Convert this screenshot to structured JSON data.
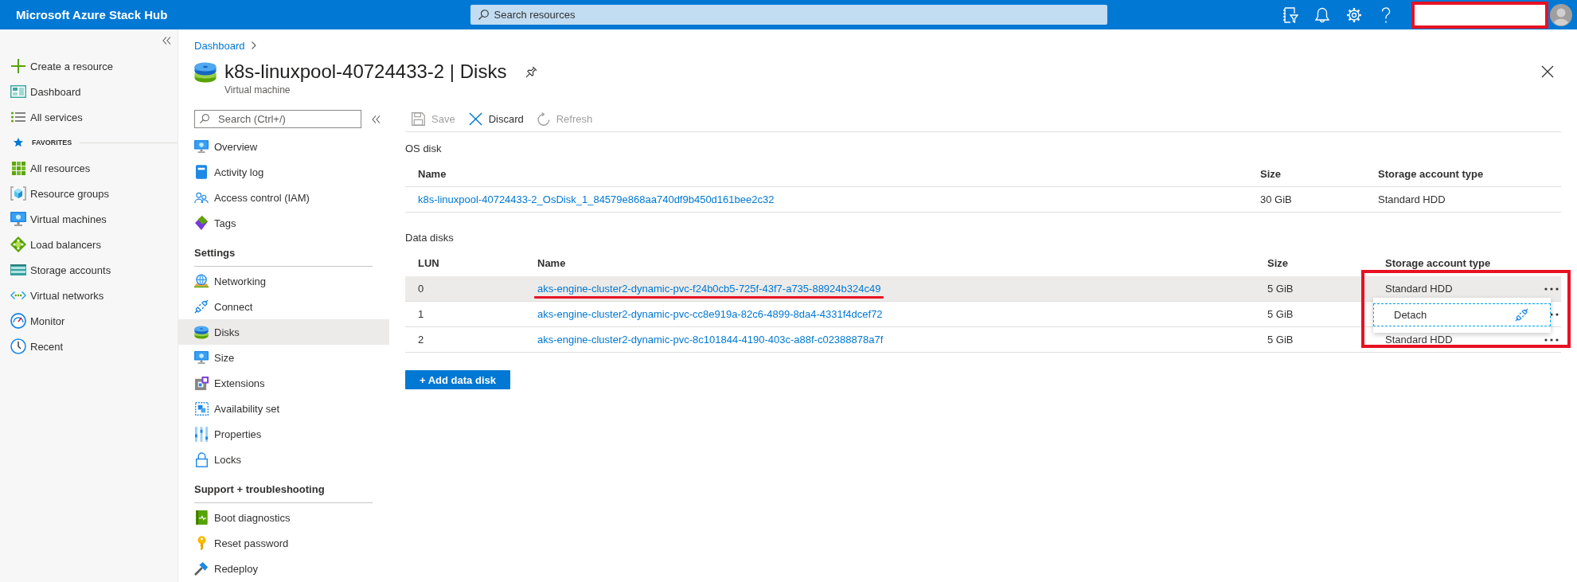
{
  "top_bar": {
    "title": "Microsoft Azure Stack Hub",
    "search": {
      "placeholder": "Search resources"
    }
  },
  "sidebar": {
    "items": [
      {
        "label": "Create a resource",
        "selected": false
      },
      {
        "label": "Dashboard",
        "selected": false
      },
      {
        "label": "All services",
        "selected": false
      }
    ],
    "favorites_label": "FAVORITES",
    "favorites": [
      {
        "label": "All resources",
        "selected": false
      },
      {
        "label": "Resource groups",
        "selected": false
      },
      {
        "label": "Virtual machines",
        "selected": false
      },
      {
        "label": "Load balancers",
        "selected": false
      },
      {
        "label": "Storage accounts",
        "selected": false
      },
      {
        "label": "Virtual networks",
        "selected": false
      },
      {
        "label": "Monitor",
        "selected": false
      },
      {
        "label": "Recent",
        "selected": false
      }
    ]
  },
  "breadcrumb": [
    {
      "label": "Dashboard"
    }
  ],
  "header": {
    "title": "k8s-linuxpool-40724433-2 | Disks",
    "subtitle": "Virtual machine"
  },
  "resource_menu": {
    "search": {
      "placeholder": "Search (Ctrl+/)"
    },
    "groups": [
      {
        "items": [
          {
            "label": "Overview",
            "selected": false
          },
          {
            "label": "Activity log",
            "selected": false
          },
          {
            "label": "Access control (IAM)",
            "selected": false
          },
          {
            "label": "Tags",
            "selected": false
          }
        ]
      },
      {
        "heading": "Settings",
        "items": [
          {
            "label": "Networking",
            "selected": false
          },
          {
            "label": "Connect",
            "selected": false
          },
          {
            "label": "Disks",
            "selected": true
          },
          {
            "label": "Size",
            "selected": false
          },
          {
            "label": "Extensions",
            "selected": false
          },
          {
            "label": "Availability set",
            "selected": false
          },
          {
            "label": "Properties",
            "selected": false
          },
          {
            "label": "Locks",
            "selected": false
          }
        ]
      },
      {
        "heading": "Support + troubleshooting",
        "items": [
          {
            "label": "Boot diagnostics",
            "selected": false
          },
          {
            "label": "Reset password",
            "selected": false
          },
          {
            "label": "Redeploy",
            "selected": false
          }
        ]
      }
    ]
  },
  "toolbar": [
    {
      "label": "Save",
      "disabled": true
    },
    {
      "label": "Discard",
      "disabled": false
    },
    {
      "label": "Refresh",
      "disabled": true
    }
  ],
  "os_disk": {
    "heading": "OS disk",
    "columns": [
      "Name",
      "Size",
      "Storage account type"
    ],
    "rows": [
      {
        "name": "k8s-linuxpool-40724433-2_OsDisk_1_84579e868aa740df9b450d161bee2c32",
        "size": "30 GiB",
        "storage_type": "Standard HDD"
      }
    ]
  },
  "data_disks": {
    "heading": "Data disks",
    "columns": [
      "LUN",
      "Name",
      "Size",
      "Storage account type"
    ],
    "rows": [
      {
        "lun": "0",
        "name": "aks-engine-cluster2-dynamic-pvc-f24b0cb5-725f-43f7-a735-88924b324c49",
        "size": "5 GiB",
        "storage_type": "Standard HDD",
        "selected": true,
        "underlined": true
      },
      {
        "lun": "1",
        "name": "aks-engine-cluster2-dynamic-pvc-cc8e919a-82c6-4899-8da4-4331f4dcef72",
        "size": "5 GiB",
        "selected": false,
        "underlined": false
      },
      {
        "lun": "2",
        "name": "aks-engine-cluster2-dynamic-pvc-8c101844-4190-403c-a88f-c02388878a7f",
        "size": "5 GiB",
        "storage_type": "Standard HDD",
        "selected": false,
        "underlined": false
      }
    ],
    "add_button": "+ Add data disk"
  },
  "context_menu": {
    "items": [
      {
        "label": "Detach",
        "focused": true
      }
    ]
  },
  "annotations": {
    "redaction_box": true,
    "highlight_outline": true
  }
}
